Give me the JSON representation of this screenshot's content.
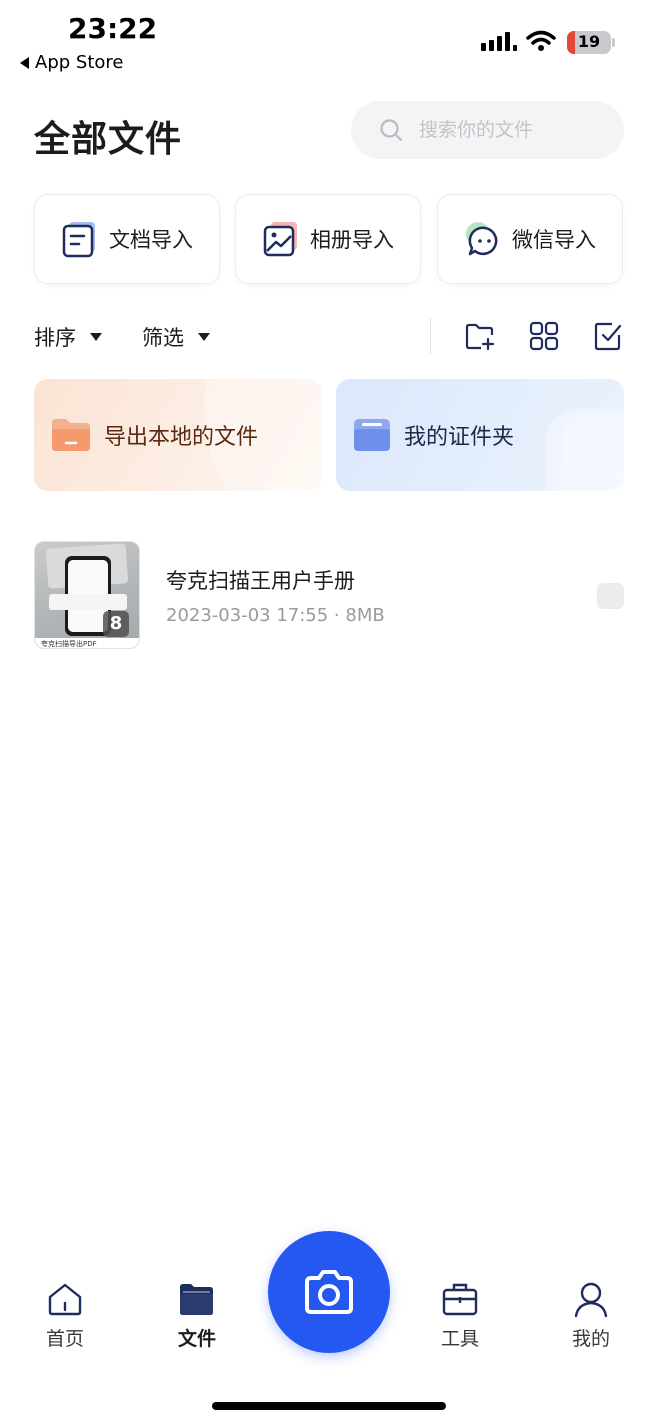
{
  "status_bar": {
    "time": "23:22",
    "back_label": "App Store",
    "battery": "19"
  },
  "header": {
    "title": "全部文件",
    "search_placeholder": "搜索你的文件"
  },
  "imports": [
    {
      "label": "文档导入",
      "icon": "document-import-icon"
    },
    {
      "label": "相册导入",
      "icon": "photo-album-icon"
    },
    {
      "label": "微信导入",
      "icon": "wechat-icon"
    }
  ],
  "toolbar": {
    "sort_label": "排序",
    "filter_label": "筛选",
    "icons": [
      "new-folder-icon",
      "grid-view-icon",
      "select-checkbox-icon"
    ]
  },
  "banners": {
    "export_label": "导出本地的文件",
    "cert_label": "我的证件夹"
  },
  "files": [
    {
      "name": "夸克扫描王用户手册",
      "meta": "2023-03-03 17:55 · 8MB",
      "page_count": "8",
      "thumb_caption": "夸克扫描导出PDF"
    }
  ],
  "tabbar": {
    "home": "首页",
    "files": "文件",
    "tools": "工具",
    "me": "我的",
    "active": "files"
  },
  "colors": {
    "accent": "#2458f0",
    "export_banner": "#fbe3d3",
    "cert_banner": "#dbe7fb"
  }
}
